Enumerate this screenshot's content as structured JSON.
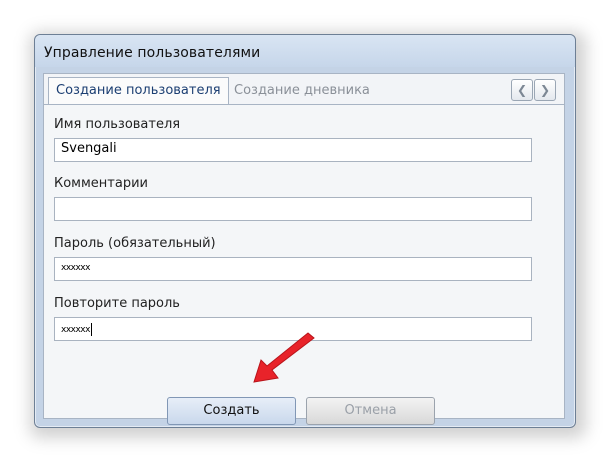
{
  "window": {
    "title": "Управление пользователями"
  },
  "tabs": [
    {
      "label": "Создание пользователя",
      "active": true
    },
    {
      "label": "Создание дневника",
      "active": false
    }
  ],
  "tab_scroll": {
    "left_icon": "chevron-left-icon",
    "right_icon": "chevron-right-icon"
  },
  "form": {
    "username_label": "Имя пользователя",
    "username_value": "Svengali",
    "comment_label": "Комментарии",
    "comment_value": "",
    "password_label": "Пароль (обязательный)",
    "password_value": "xxxxxx",
    "repeat_label": "Повторите пароль",
    "repeat_value": "xxxxxx"
  },
  "buttons": {
    "create": "Создать",
    "cancel": "Отмена"
  },
  "colors": {
    "arrow": "#e8232a",
    "accent": "#1b3e72"
  }
}
